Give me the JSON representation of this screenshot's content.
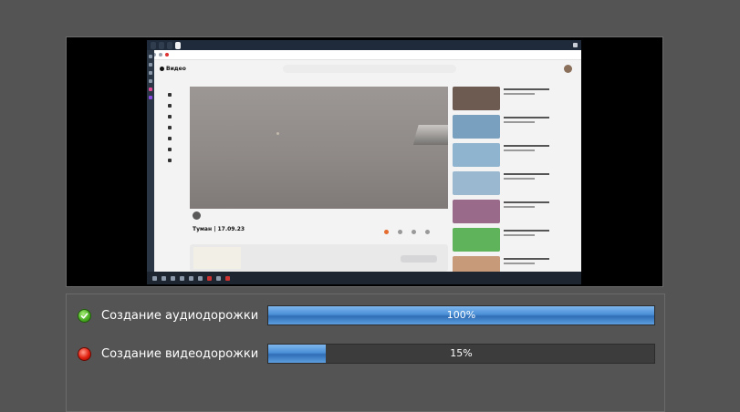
{
  "tasks": [
    {
      "label": "Создание аудиодорожки",
      "status": "done",
      "status_icon": "check-icon",
      "progress_percent": 100,
      "progress_text": "100%"
    },
    {
      "label": "Создание видеодорожки",
      "status": "in-progress",
      "status_icon": "red-dot-icon",
      "progress_percent": 15,
      "progress_text": "15%"
    }
  ],
  "preview": {
    "page_logo": "Видео",
    "video_title": "Туман | 17.09.23"
  },
  "colors": {
    "background": "#545454",
    "progress_fill": "#4a8fd6",
    "status_done": "#4caf24",
    "status_active": "#e02010"
  }
}
